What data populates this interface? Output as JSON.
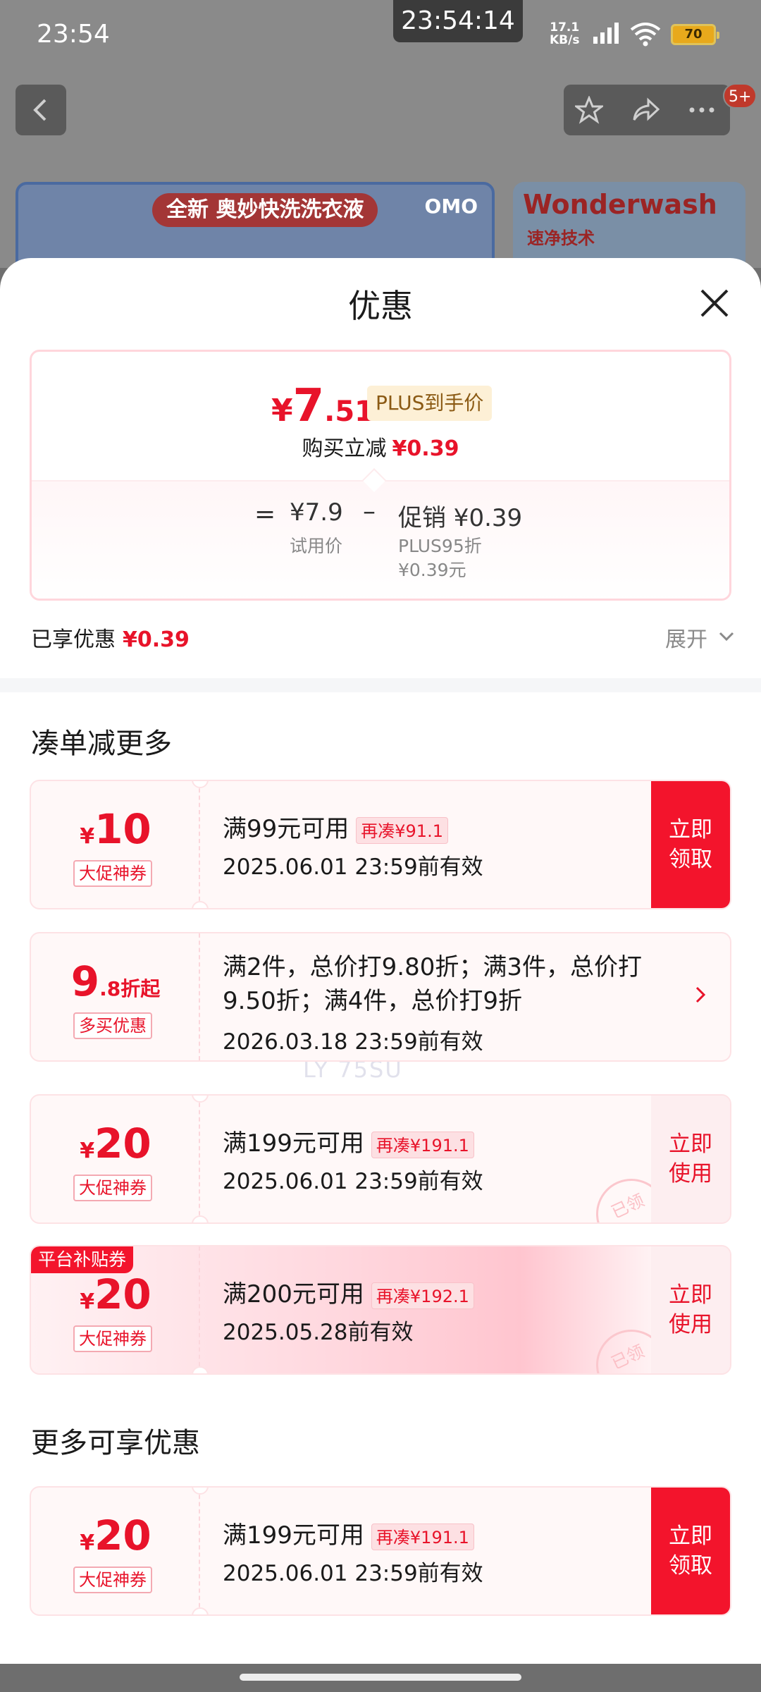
{
  "status_bar": {
    "time": "23:54",
    "clock": "23:54:14",
    "net_speed_value": "17.1",
    "net_speed_unit": "KB/s",
    "battery": "70"
  },
  "nav": {
    "badge": "5+"
  },
  "background_banners": {
    "left_tag": "全新 奥妙快洗洗衣液",
    "left_logo": "OMO",
    "right_title": "Wonderwash",
    "right_sub": "速净技术"
  },
  "sheet": {
    "title": "优惠"
  },
  "price_summary": {
    "currency": "¥",
    "final_int": "7",
    "final_dec": ".51",
    "plus_tag": "PLUS到手价",
    "reduce_label": "购买立减",
    "reduce_amount": "¥0.39",
    "equals": "=",
    "base_price": "¥7.9",
    "base_label": "试用价",
    "minus": "–",
    "promo": "促销 ¥0.39",
    "promo_detail_1": "PLUS95折",
    "promo_detail_2": "¥0.39元"
  },
  "enjoyed": {
    "label": "已享优惠",
    "amount": "¥0.39",
    "expand_label": "展开"
  },
  "sections": {
    "combine": "凑单减更多",
    "more": "更多可享优惠"
  },
  "watermark": "LY 75SU",
  "coupons": [
    {
      "currency": "¥",
      "amount": "10",
      "kind": "大促神券",
      "condition": "满99元可用",
      "more_tag": "再凑¥91.1",
      "valid": "2025.06.01 23:59前有效",
      "action_1": "立即",
      "action_2": "领取"
    },
    {
      "amount_int": "9",
      "amount_rest": ".8折起",
      "kind": "多买优惠",
      "condition_line_1": "满2件，总价打9.80折；满3件，总价打",
      "condition_line_2": "9.50折；满4件，总价打9折",
      "valid": "2026.03.18 23:59前有效"
    },
    {
      "currency": "¥",
      "amount": "20",
      "kind": "大促神券",
      "condition": "满199元可用",
      "more_tag": "再凑¥191.1",
      "valid": "2025.06.01 23:59前有效",
      "action_1": "立即",
      "action_2": "使用",
      "stamp": "已领"
    },
    {
      "platform_tag": "平台补贴券",
      "currency": "¥",
      "amount": "20",
      "kind": "大促神券",
      "condition": "满200元可用",
      "more_tag": "再凑¥192.1",
      "valid": "2025.05.28前有效",
      "action_1": "立即",
      "action_2": "使用",
      "stamp": "已领"
    },
    {
      "currency": "¥",
      "amount": "20",
      "kind": "大促神券",
      "condition": "满199元可用",
      "more_tag": "再凑¥191.1",
      "valid": "2025.06.01 23:59前有效",
      "action_1": "立即",
      "action_2": "领取"
    }
  ],
  "icons": {
    "back": "back-icon",
    "favorite": "star-icon",
    "share": "share-icon",
    "more": "more-icon",
    "close": "close-icon",
    "expand": "chevron-down-icon",
    "detail": "chevron-right-icon"
  },
  "colors": {
    "accent": "#e8132a",
    "claim_bg": "#f3142c",
    "plus_tag_bg": "#fdf0d6"
  }
}
